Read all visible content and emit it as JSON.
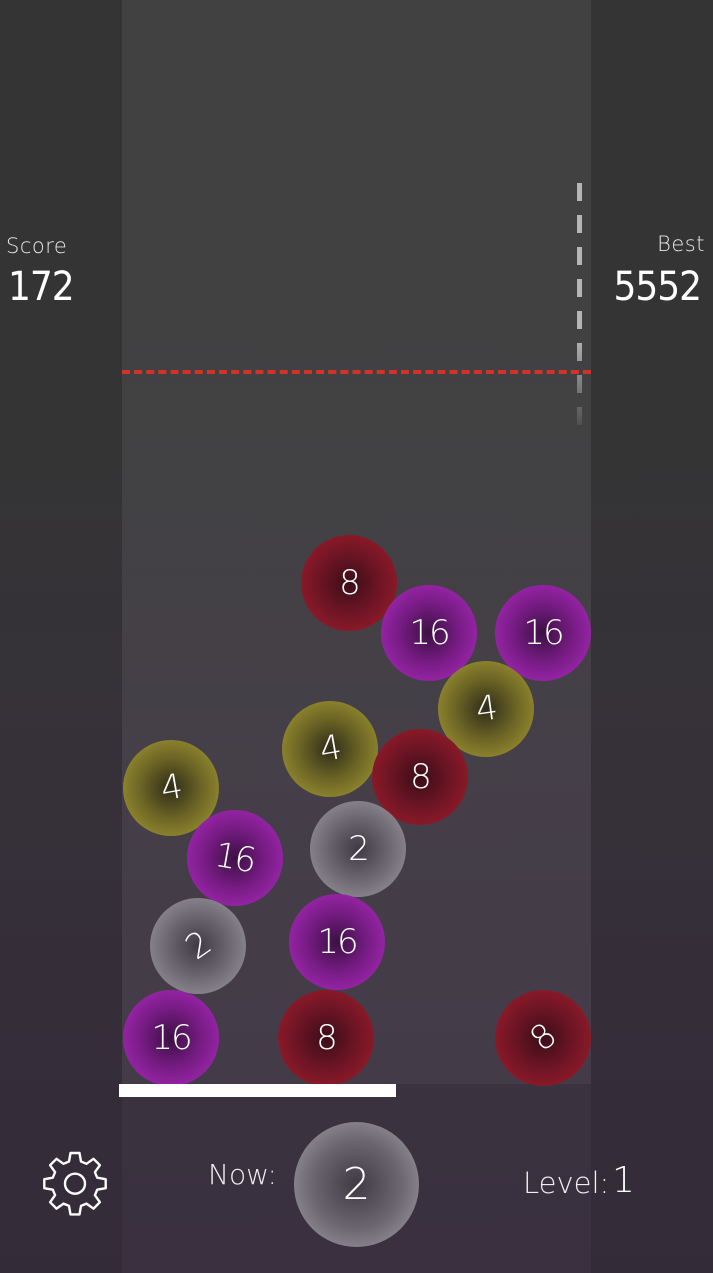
{
  "score": {
    "label": "Score",
    "value": "172"
  },
  "best": {
    "label": "Best",
    "value": "5552"
  },
  "balls": [
    {
      "value": "8",
      "color": "red"
    },
    {
      "value": "16",
      "color": "purple"
    },
    {
      "value": "16",
      "color": "purple"
    },
    {
      "value": "4",
      "color": "yellow"
    },
    {
      "value": "4",
      "color": "yellow"
    },
    {
      "value": "8",
      "color": "red"
    },
    {
      "value": "4",
      "color": "yellow"
    },
    {
      "value": "2",
      "color": "grey"
    },
    {
      "value": "16",
      "color": "purple"
    },
    {
      "value": "2",
      "color": "grey"
    },
    {
      "value": "16",
      "color": "purple"
    },
    {
      "value": "16",
      "color": "purple"
    },
    {
      "value": "8",
      "color": "red"
    },
    {
      "value": "8",
      "color": "red"
    }
  ],
  "controls": {
    "settings_icon": "gear-icon",
    "now_label": "Now:",
    "now_value": "2",
    "level_label": "Level:",
    "level_value": "1"
  },
  "colors": {
    "danger_line": "#d23228",
    "red": "#a71e2b",
    "purple": "#b22cc4",
    "yellow": "#aba133",
    "grey": "#a39fa8"
  }
}
